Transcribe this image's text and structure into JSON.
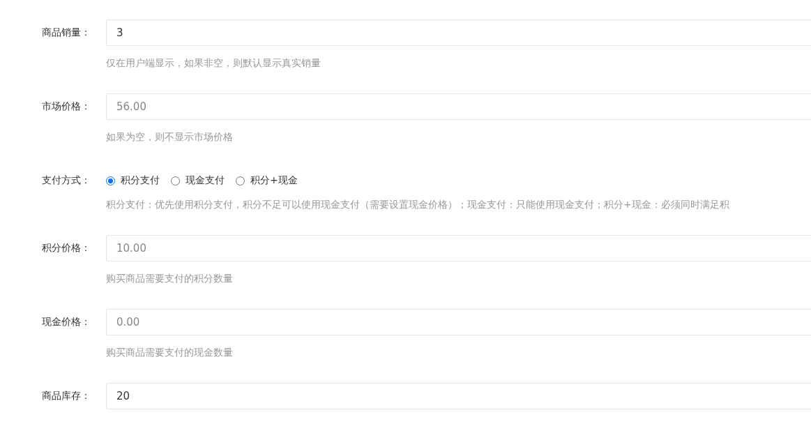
{
  "fields": [
    {
      "kind": "input",
      "label": "商品销量：",
      "value": "3",
      "hint": "仅在用户端显示，如果非空，则默认显示真实销量"
    },
    {
      "kind": "input",
      "label": "市场价格：",
      "placeholder": "56.00",
      "hint": "如果为空，则不显示市场价格"
    },
    {
      "kind": "radio",
      "label": "支付方式：",
      "options": [
        {
          "label": "积分支付",
          "selected": true
        },
        {
          "label": "现金支付",
          "selected": false
        },
        {
          "label": "积分+现金",
          "selected": false
        }
      ],
      "hint": "积分支付：优先使用积分支付，积分不足可以使用现金支付（需要设置现金价格）；现金支付：只能使用现金支付；积分+现金：必须同时满足积"
    },
    {
      "kind": "input",
      "label": "积分价格：",
      "placeholder": "10.00",
      "hint": "购买商品需要支付的积分数量"
    },
    {
      "kind": "input",
      "label": "现金价格：",
      "placeholder": "0.00",
      "hint": "购买商品需要支付的现金数量"
    },
    {
      "kind": "input",
      "label": "商品库存：",
      "value": "20"
    }
  ]
}
